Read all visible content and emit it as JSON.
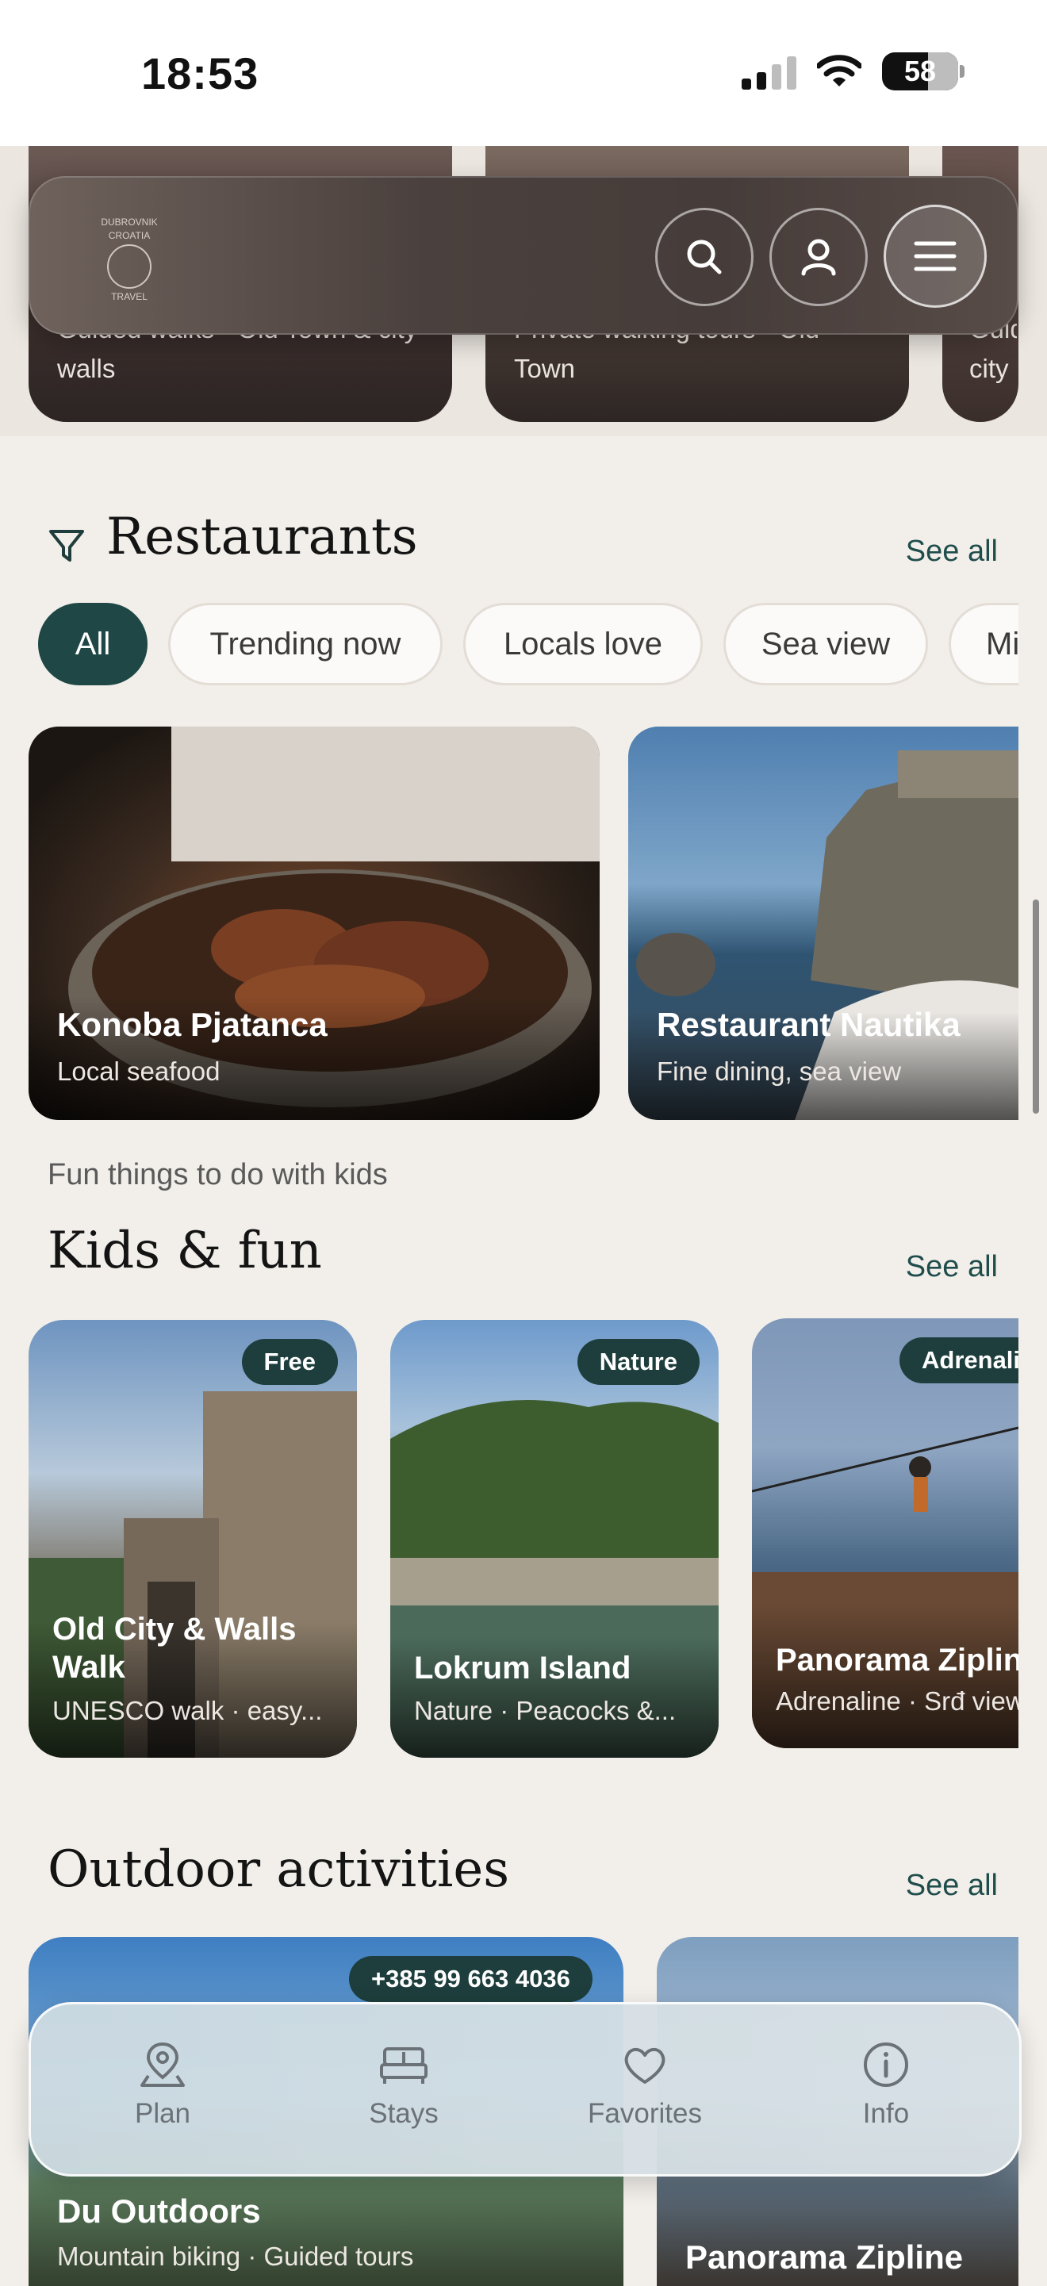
{
  "status_bar": {
    "time": "18:53",
    "battery": "58"
  },
  "tours": [
    {
      "subtitle": "Guided walks · Old Town & city walls"
    },
    {
      "subtitle": "Private walking tours · Old Town"
    },
    {
      "subtitle": "Guid city"
    }
  ],
  "header": {
    "logo_lines": [
      "DUBROVNIK",
      "CROATIA",
      "TRAVEL"
    ]
  },
  "restaurants": {
    "title": "Restaurants",
    "see_all": "See all",
    "filters": [
      "All",
      "Trending now",
      "Locals love",
      "Sea view",
      "Mi"
    ],
    "active_filter": "All",
    "cards": [
      {
        "name": "Konoba Pjatanca",
        "subtitle": "Local seafood"
      },
      {
        "name": "Restaurant Nautika",
        "subtitle": "Fine dining, sea view"
      }
    ]
  },
  "kids": {
    "eyebrow": "Fun things to do with kids",
    "title": "Kids & fun",
    "see_all": "See all",
    "cards": [
      {
        "badge": "Free",
        "name": "Old City & Walls Walk",
        "subtitle": "UNESCO walk · easy..."
      },
      {
        "badge": "Nature",
        "name": "Lokrum Island",
        "subtitle": "Nature · Peacocks &..."
      },
      {
        "badge": "Adrenalin",
        "name": "Panorama Zipline",
        "subtitle": "Adrenaline · Srđ view"
      }
    ]
  },
  "outdoor": {
    "title": "Outdoor activities",
    "see_all": "See all",
    "cards": [
      {
        "phone": "+385 99 663 4036",
        "name": "Du Outdoors",
        "subtitle": "Mountain biking · Guided tours"
      },
      {
        "name": "Panorama Zipline"
      }
    ]
  },
  "bottom_nav": [
    {
      "label": "Plan",
      "icon": "map-pin-icon"
    },
    {
      "label": "Stays",
      "icon": "bed-icon"
    },
    {
      "label": "Favorites",
      "icon": "heart-icon"
    },
    {
      "label": "Info",
      "icon": "info-icon"
    }
  ],
  "colors": {
    "accent": "#1f4745",
    "background": "#f2efea",
    "link": "#1f4d4c"
  }
}
